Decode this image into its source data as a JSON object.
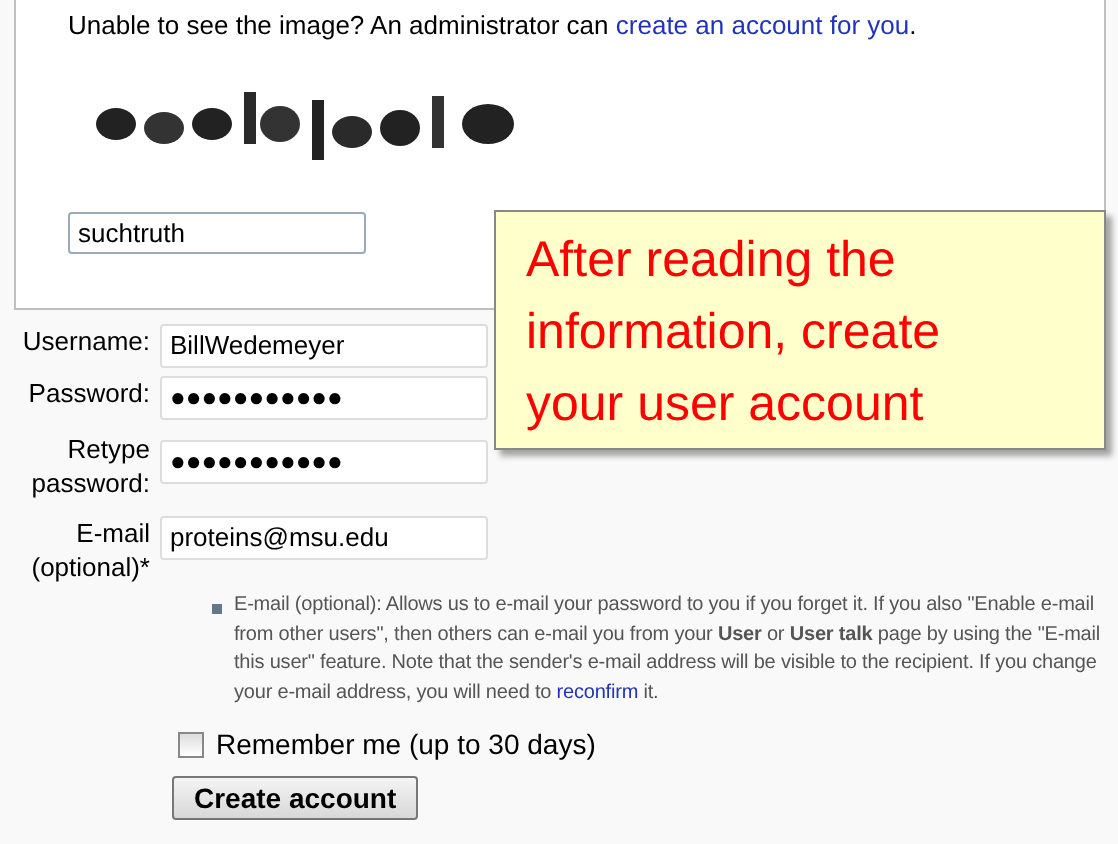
{
  "captcha": {
    "prompt": "Unable to see the image? An administrator can",
    "link": "create an account for you",
    "after": ".",
    "answer": "suchtruth"
  },
  "fields": [
    {
      "label": "Username:",
      "value": "BillWedemeyer"
    },
    {
      "label": "Password:",
      "value": "●●●●●●●●●●●"
    },
    {
      "label": "Retype password:",
      "value": "●●●●●●●●●●●"
    },
    {
      "label": "E-mail (optional)*",
      "value": "proteins@msu.edu"
    }
  ],
  "help": {
    "text": "E-mail (optional): Allows us to e-mail your password to you if you forget it. If you also \"Enable e-mail from other users\", then others can e-mail you from your **User** or **User talk** page by using the \"E-mail this user\" feature. Note that the sender's e-mail address will be visible to the recipient. If you change your e-mail address, you will need to",
    "link": "reconfirm",
    "after": " it."
  },
  "remember": {
    "label": "Remember me (up to 30 days)",
    "checked": false
  },
  "submit": "Create account",
  "callout": "After reading the information, create your user account"
}
